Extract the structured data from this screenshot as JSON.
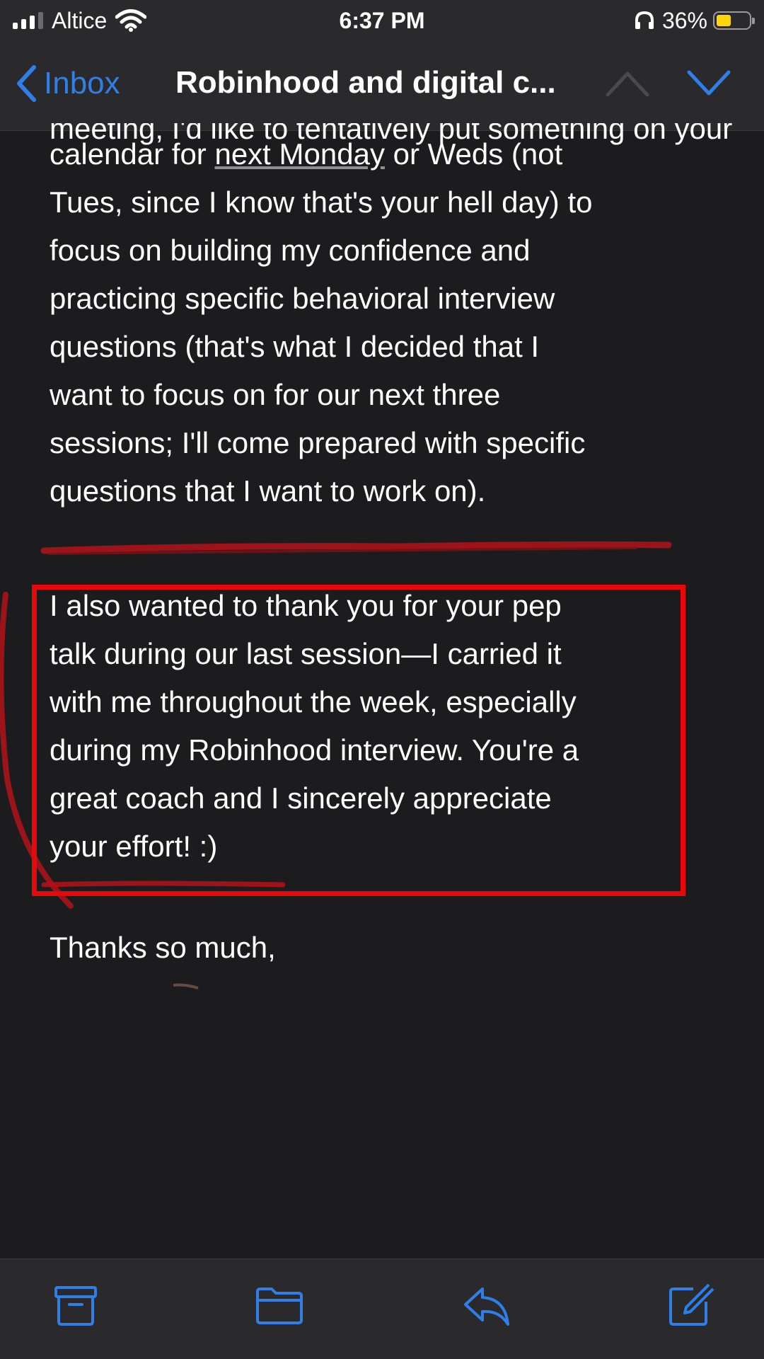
{
  "status_bar": {
    "carrier": "Altice",
    "time": "6:37 PM",
    "battery_percent": "36%",
    "icons": [
      "signal-icon",
      "wifi-icon",
      "headphones-icon",
      "battery-icon"
    ]
  },
  "nav": {
    "back_label": "Inbox",
    "title": "Robinhood and digital c...",
    "icons": [
      "chevron-left-icon",
      "chevron-up-icon",
      "chevron-down-icon"
    ]
  },
  "email": {
    "partial_first_line": "meeting, I'd like to tentatively put something on your",
    "paragraph1_lines": [
      {
        "before": "calendar for ",
        "link": "next Monday",
        "after": " or Weds (not"
      },
      {
        "text": "Tues, since I know that's your hell day) to"
      },
      {
        "text": "focus on building my confidence and"
      },
      {
        "text": "practicing specific behavioral interview"
      },
      {
        "text": "questions (that's what I decided that I"
      },
      {
        "text": "want to focus on for our next three"
      },
      {
        "text": "sessions; I'll come prepared with specific"
      },
      {
        "text": "questions that I want to work on)."
      }
    ],
    "highlighted_lines": [
      "I also wanted to thank you for your pep",
      "talk during our last session—I carried it",
      "with me throughout the week, especially",
      "during my Robinhood interview. You're a",
      "great coach and I sincerely appreciate",
      "your effort! :)"
    ],
    "closing": "Thanks so much,"
  },
  "toolbar": {
    "icons": [
      "archive-icon",
      "folder-icon",
      "reply-icon",
      "compose-icon"
    ]
  },
  "colors": {
    "accent": "#2f7fe6",
    "background": "#1c1c1e",
    "bar": "#2a2a2d",
    "highlight_border": "#e8080c",
    "battery": "#ffd60a"
  }
}
